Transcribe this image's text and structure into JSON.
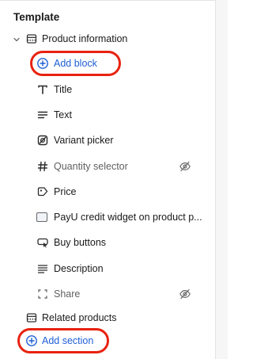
{
  "panel": {
    "heading": "Template",
    "section_product": "Product information",
    "add_block": "Add block",
    "blocks": [
      {
        "label": "Title",
        "icon": "title-T-icon",
        "muted": false,
        "hidden": false
      },
      {
        "label": "Text",
        "icon": "text-lines-icon",
        "muted": false,
        "hidden": false
      },
      {
        "label": "Variant picker",
        "icon": "variant-picker-icon",
        "muted": false,
        "hidden": false
      },
      {
        "label": "Quantity selector",
        "icon": "hash-icon",
        "muted": true,
        "hidden": true
      },
      {
        "label": "Price",
        "icon": "price-tag-icon",
        "muted": false,
        "hidden": false
      },
      {
        "label": "PayU credit widget on product p...",
        "icon": "app-block-icon",
        "muted": false,
        "hidden": false
      },
      {
        "label": "Buy buttons",
        "icon": "buy-buttons-icon",
        "muted": false,
        "hidden": false
      },
      {
        "label": "Description",
        "icon": "text-lines-icon",
        "muted": false,
        "hidden": false
      },
      {
        "label": "Share",
        "icon": "share-bracket-icon",
        "muted": true,
        "hidden": true
      }
    ],
    "section_related": "Related products",
    "add_section": "Add section"
  },
  "colors": {
    "accent_blue": "#1f5fd6",
    "highlight_red": "#e8220f"
  }
}
